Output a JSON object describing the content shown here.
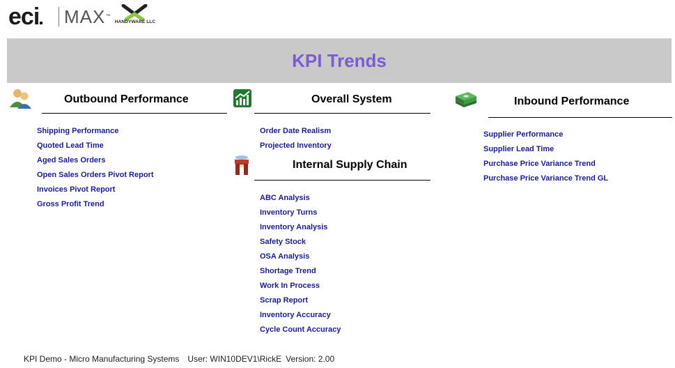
{
  "header": {
    "logo_eci": "eci",
    "logo_max": "MAX",
    "logo_tm": "™",
    "partner_logo_text": "HANDYWARE LLC"
  },
  "banner": {
    "title": "KPI Trends"
  },
  "outbound": {
    "title": "Outbound Performance",
    "links": [
      "Shipping Performance",
      "Quoted Lead Time",
      "Aged Sales Orders",
      "Open Sales Orders Pivot Report",
      "Invoices Pivot Report",
      "Gross Profit Trend"
    ]
  },
  "overall": {
    "title": "Overall System",
    "links": [
      "Order Date Realism",
      "Projected Inventory"
    ]
  },
  "internal": {
    "title": "Internal Supply Chain",
    "links": [
      "ABC Analysis",
      "Inventory Turns",
      "Inventory Analysis",
      "Safety Stock",
      "OSA Analysis",
      "Shortage Trend",
      "Work In Process",
      "Scrap Report",
      "Inventory Accuracy",
      "Cycle Count Accuracy"
    ]
  },
  "inbound": {
    "title": "Inbound Performance",
    "links": [
      "Supplier Performance",
      "Supplier Lead Time",
      "Purchase Price Variance Trend",
      "Purchase Price Variance Trend GL"
    ]
  },
  "footer": {
    "company": "KPI Demo - Micro Manufacturing Systems",
    "user": "User: WIN10DEV1\\RickE",
    "version": "Version: 2.00"
  },
  "colors": {
    "banner_bg": "#c9c9c9",
    "title": "#7a5dd3",
    "link": "#1a1aa6"
  },
  "icons": [
    "people-icon",
    "growth-chart-icon",
    "money-stack-icon",
    "warehouse-worker-icon"
  ]
}
